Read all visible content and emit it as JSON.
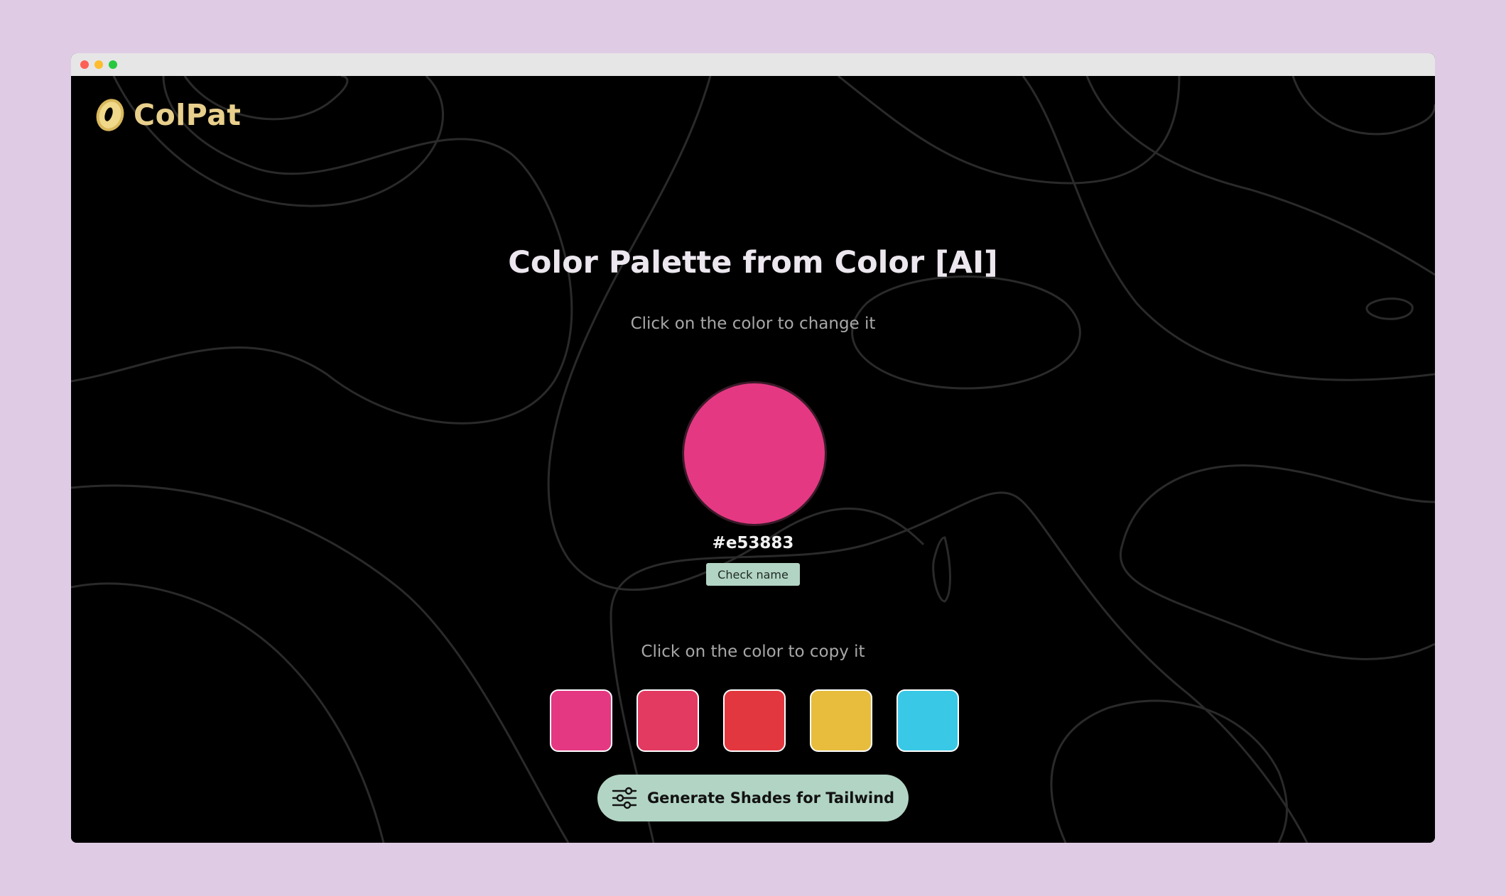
{
  "app": {
    "name": "ColPat"
  },
  "main": {
    "title": "Color Palette from Color [AI]",
    "change_hint": "Click on the color to change it",
    "selected_color": "#e53883",
    "selected_hex_label": "#e53883",
    "check_name_label": "Check name",
    "copy_hint": "Click on the color to copy it",
    "palette": [
      "#e53883",
      "#e33a62",
      "#e3373f",
      "#e8bd3e",
      "#39c8e6"
    ],
    "generate_label": "Generate Shades for Tailwind"
  },
  "icons": {
    "logo": "donut-logo-icon",
    "generate": "sliders-icon"
  },
  "colors": {
    "page_background": "#dfcce4",
    "app_background": "#000000",
    "accent": "#b2d4c4",
    "logo_text": "#e8cf8c"
  }
}
